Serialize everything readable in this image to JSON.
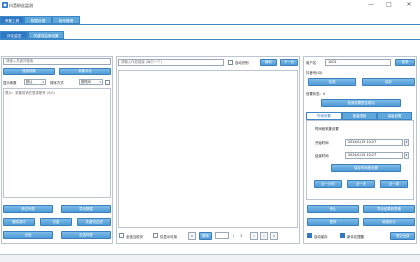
{
  "window": {
    "title": "抖音粉丝监测",
    "min": "—",
    "max": "□",
    "close": "✕"
  },
  "tabs_row1": [
    "采集工具",
    "数据处理",
    "帐号管理"
  ],
  "tabs_row2": [
    "评论监控",
    "关键词监测设置"
  ],
  "left": {
    "search_placeholder": "请输入关键词搜索",
    "btn_search": "搜索视频",
    "btn_collect": "采集评论",
    "filter_label_a": "显示条数",
    "filter_sel_a": "默认",
    "filter_label_b": "排序方式",
    "filter_sel_b": "按时间",
    "hint": "提示：采集前请先登录账号 (0/0)",
    "buttons": [
      "清空列表",
      "导出数据",
      "删除选中",
      "去重",
      "关键词过滤",
      "全选",
      "反选列表"
    ]
  },
  "center": {
    "url_placeholder": "请输入作品链接 (每行一个)",
    "check_auto": "自动识别",
    "btn_parse": "解析",
    "btn_next": "下一页",
    "footer_check_a": "全选当前页",
    "footer_check_b": "仅显示可用",
    "page_btn": "跳转",
    "page_sep": "/",
    "page_total": "1"
  },
  "right": {
    "account_label": "用户名",
    "account_value": "1001",
    "btn_login": "登录",
    "id_label": "抖音号(ID)",
    "btn_check": "检测",
    "btn_save": "保存",
    "status_label": "设置状态：0",
    "btn_status": "检测设置是否成功",
    "subtabs": [
      "时间设置",
      "数量限制",
      "高级设置"
    ],
    "time_group": "时间段采集设置",
    "start_label": "开始时间",
    "start_value": "2024/1/15 10:27",
    "end_label": "结束时间",
    "end_value": "2024/1/15 10:27",
    "btn_apply": "保存时间段设置",
    "quick": [
      "近一小时",
      "近一天",
      "近一周"
    ],
    "btn_stop": "停止",
    "btn_export": "导出结果到表格",
    "btn_pause": "暂停",
    "btn_continue": "继续执行",
    "check_save": "自动保存",
    "check_alert": "新评论提醒",
    "btn_clear": "清空全部"
  },
  "colors": {
    "accent": "#2f78c4",
    "tab": "#5fa8dc",
    "border": "#bcc6d2"
  }
}
